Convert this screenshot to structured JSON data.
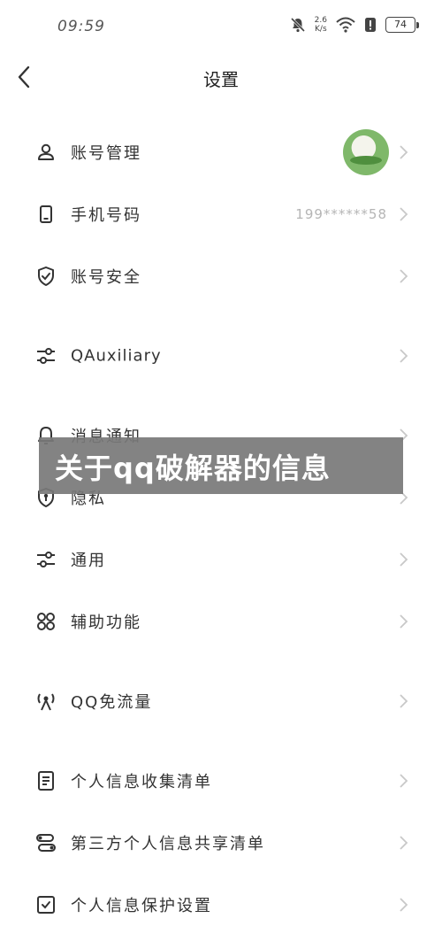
{
  "status_bar": {
    "time": "09:59",
    "speed_value": "2.6",
    "speed_unit": "K/s",
    "battery": "74"
  },
  "header": {
    "title": "设置"
  },
  "rows": [
    {
      "label": "账号管理",
      "icon": "person-icon",
      "has_avatar": true
    },
    {
      "label": "手机号码",
      "icon": "phone-icon",
      "value": "199******58"
    },
    {
      "label": "账号安全",
      "icon": "shield-check-icon"
    },
    {
      "label": "QAuxiliary",
      "icon": "sliders-icon"
    },
    {
      "label": "消息通知",
      "icon": "bell-icon"
    },
    {
      "label": "隐私",
      "icon": "privacy-shield-icon"
    },
    {
      "label": "通用",
      "icon": "sliders-icon"
    },
    {
      "label": "辅助功能",
      "icon": "grid-circles-icon"
    },
    {
      "label": "QQ免流量",
      "icon": "signal-tower-icon"
    },
    {
      "label": "个人信息收集清单",
      "icon": "document-icon"
    },
    {
      "label": "第三方个人信息共享清单",
      "icon": "share-toggle-icon"
    },
    {
      "label": "个人信息保护设置",
      "icon": "checkbox-icon"
    }
  ],
  "banner": {
    "text": "关于qq破解器的信息"
  },
  "colors": {
    "background": "#ffffff",
    "banner": "#787878",
    "chevron": "#c8c8c8",
    "value_text": "#b5b5b5"
  }
}
